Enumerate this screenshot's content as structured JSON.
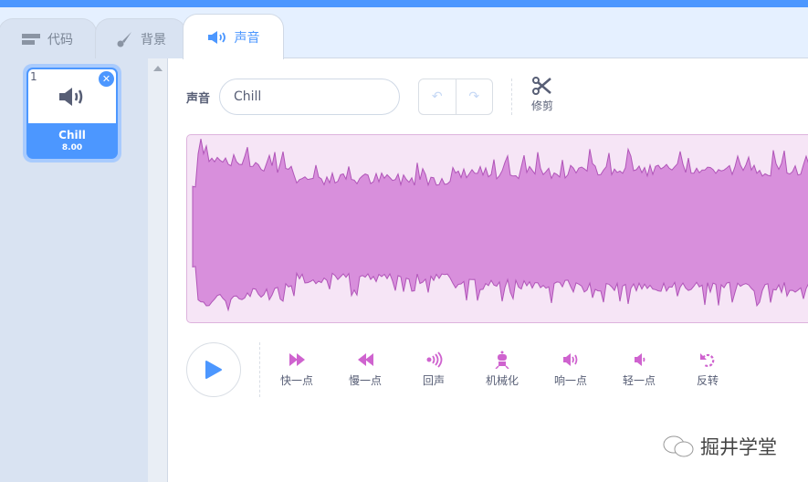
{
  "tabs": [
    {
      "label": "代码",
      "icon": "code-blocks-icon"
    },
    {
      "label": "背景",
      "icon": "brush-icon"
    },
    {
      "label": "声音",
      "icon": "speaker-icon",
      "active": true
    }
  ],
  "sound_list": [
    {
      "index": "1",
      "name": "Chill",
      "duration": "8.00",
      "selected": true
    }
  ],
  "editor": {
    "name_label": "声音",
    "name_value": "Chill",
    "trim_label": "修剪"
  },
  "effects": [
    {
      "label": "快一点",
      "icon": "faster-icon"
    },
    {
      "label": "慢一点",
      "icon": "slower-icon"
    },
    {
      "label": "回声",
      "icon": "echo-icon"
    },
    {
      "label": "机械化",
      "icon": "robot-icon"
    },
    {
      "label": "响一点",
      "icon": "louder-icon"
    },
    {
      "label": "轻一点",
      "icon": "softer-icon"
    },
    {
      "label": "反转",
      "icon": "reverse-icon"
    }
  ],
  "colors": {
    "accent": "#4c97ff",
    "wave_fill": "#d88fdc",
    "wave_stroke": "#b055b8",
    "effect": "#cf63cf"
  },
  "watermark": "掘井学堂"
}
